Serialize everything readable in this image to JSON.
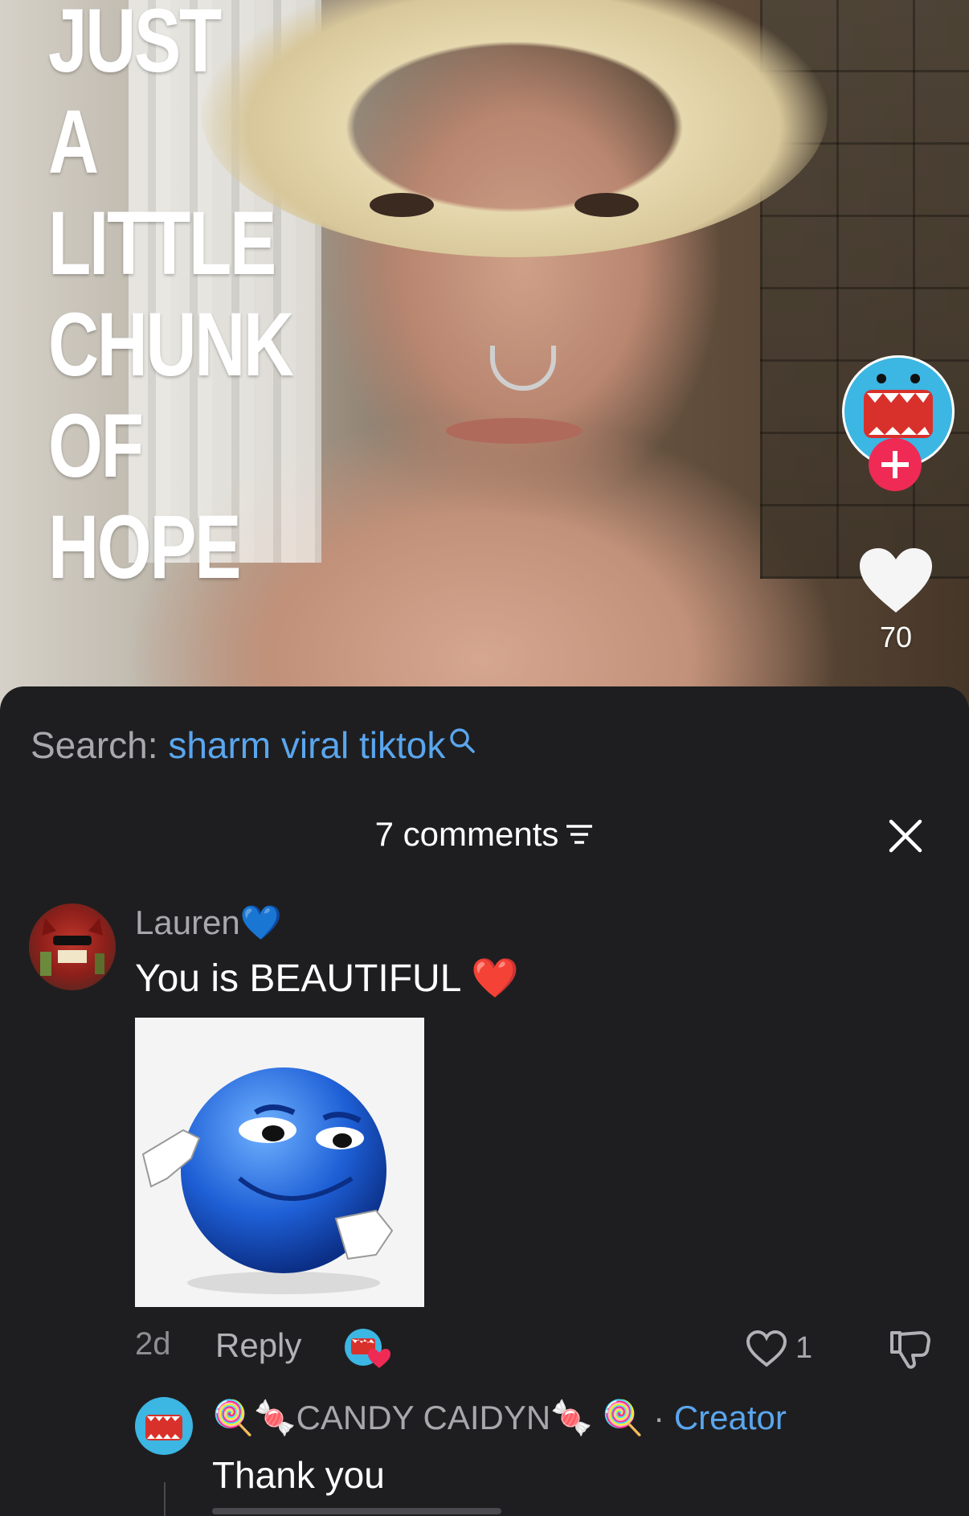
{
  "video": {
    "overlay_title_lines": [
      "JUST",
      "A",
      "LITTLE",
      "CHUNK",
      "OF",
      "HOPE"
    ],
    "like_count": "70",
    "icons": {
      "avatar": "creator-avatar",
      "follow": "plus-icon",
      "like": "heart-icon"
    },
    "colors": {
      "follow_button": "#ee2a55",
      "avatar_bg": "#3cb6e2"
    }
  },
  "search": {
    "prefix": "Search:",
    "query": "sharm viral tiktok",
    "icon": "search-icon"
  },
  "comments_header": {
    "label": "7 comments",
    "icons": {
      "filter": "filter-icon",
      "close": "close-icon"
    }
  },
  "comment": {
    "username": "Lauren💙",
    "text": "You is BEAUTIFUL ❤️",
    "time": "2d",
    "reply_label": "Reply",
    "like_count": "1",
    "icons": {
      "creator_liked": "creator-liked-icon",
      "like": "heart-outline-icon",
      "dislike": "thumbs-down-icon",
      "sticker": "blue-smirk-emoji-sticker"
    }
  },
  "reply": {
    "username": "🍭🍬CANDY CAIDYN🍬 🍭",
    "separator": "·",
    "creator_tag": "Creator",
    "text": "Thank you"
  },
  "colors": {
    "sheet_bg": "#1e1e20",
    "link_blue": "#5aa6ee",
    "muted_text": "#a8a8ac"
  }
}
